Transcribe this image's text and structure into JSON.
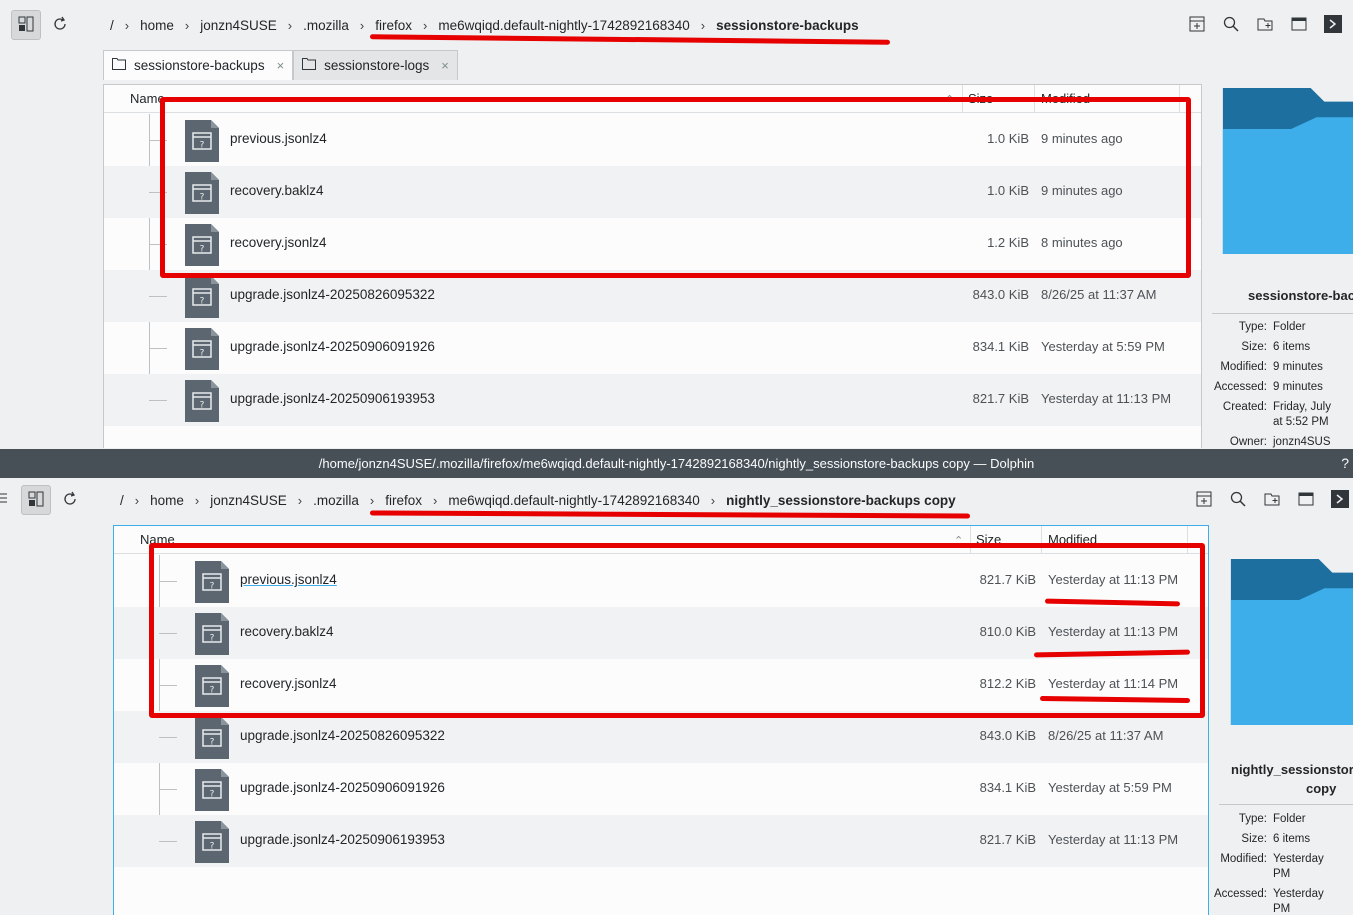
{
  "colors": {
    "accent": "#3daee9",
    "folder_dark": "#1d6fa0",
    "folder_light": "#3daee9",
    "titlebar": "#475057",
    "annotation_red": "#e60000",
    "file_icon": "#5b6670"
  },
  "top_window": {
    "breadcrumb": [
      "/",
      "home",
      "jonzn4SUSE",
      ".mozilla",
      "firefox",
      "me6wqiqd.default-nightly-1742892168340",
      "sessionstore-backups"
    ],
    "tabs": [
      {
        "label": "sessionstore-backups",
        "icon": "folder-icon",
        "close": "×"
      },
      {
        "label": "sessionstore-logs",
        "icon": "folder-icon",
        "close": "×"
      }
    ],
    "columns": {
      "name": "Name",
      "size": "Size",
      "modified": "Modified"
    },
    "files": [
      {
        "name": "previous.jsonlz4",
        "size": "1.0 KiB",
        "modified": "9 minutes ago"
      },
      {
        "name": "recovery.baklz4",
        "size": "1.0 KiB",
        "modified": "9 minutes ago"
      },
      {
        "name": "recovery.jsonlz4",
        "size": "1.2 KiB",
        "modified": "8 minutes ago"
      },
      {
        "name": "upgrade.jsonlz4-20250826095322",
        "size": "843.0 KiB",
        "modified": "8/26/25 at 11:37 AM"
      },
      {
        "name": "upgrade.jsonlz4-20250906091926",
        "size": "834.1 KiB",
        "modified": "Yesterday at 5:59 PM"
      },
      {
        "name": "upgrade.jsonlz4-20250906193953",
        "size": "821.7 KiB",
        "modified": "Yesterday at 11:13 PM"
      }
    ],
    "info": {
      "folder_name": "sessionstore-backu",
      "props": [
        {
          "k": "Type:",
          "v": "Folder"
        },
        {
          "k": "Size:",
          "v": "6 items"
        },
        {
          "k": "Modified:",
          "v": "9 minutes"
        },
        {
          "k": "Accessed:",
          "v": "9 minutes"
        },
        {
          "k": "Created:",
          "v": "Friday, July"
        },
        {
          "k": "",
          "v": "at 5:52 PM"
        },
        {
          "k": "Owner:",
          "v": "jonzn4SUS"
        }
      ]
    }
  },
  "bottom_window": {
    "title": "/home/jonzn4SUSE/.mozilla/firefox/me6wqiqd.default-nightly-1742892168340/nightly_sessionstore-backups copy — Dolphin",
    "help": "?",
    "breadcrumb": [
      "/",
      "home",
      "jonzn4SUSE",
      ".mozilla",
      "firefox",
      "me6wqiqd.default-nightly-1742892168340",
      "nightly_sessionstore-backups copy"
    ],
    "columns": {
      "name": "Name",
      "size": "Size",
      "modified": "Modified"
    },
    "files": [
      {
        "name": "previous.jsonlz4",
        "size": "821.7 KiB",
        "modified": "Yesterday at 11:13 PM"
      },
      {
        "name": "recovery.baklz4",
        "size": "810.0 KiB",
        "modified": "Yesterday at 11:13 PM"
      },
      {
        "name": "recovery.jsonlz4",
        "size": "812.2 KiB",
        "modified": "Yesterday at 11:14 PM"
      },
      {
        "name": "upgrade.jsonlz4-20250826095322",
        "size": "843.0 KiB",
        "modified": "8/26/25 at 11:37 AM"
      },
      {
        "name": "upgrade.jsonlz4-20250906091926",
        "size": "834.1 KiB",
        "modified": "Yesterday at 5:59 PM"
      },
      {
        "name": "upgrade.jsonlz4-20250906193953",
        "size": "821.7 KiB",
        "modified": "Yesterday at 11:13 PM"
      }
    ],
    "info": {
      "folder_name_1": "nightly_sessionstore",
      "folder_name_2": "copy",
      "props": [
        {
          "k": "Type:",
          "v": "Folder"
        },
        {
          "k": "Size:",
          "v": "6 items"
        },
        {
          "k": "Modified:",
          "v": "Yesterday"
        },
        {
          "k": "",
          "v": "PM"
        },
        {
          "k": "Accessed:",
          "v": "Yesterday"
        },
        {
          "k": "",
          "v": "PM"
        }
      ]
    }
  }
}
